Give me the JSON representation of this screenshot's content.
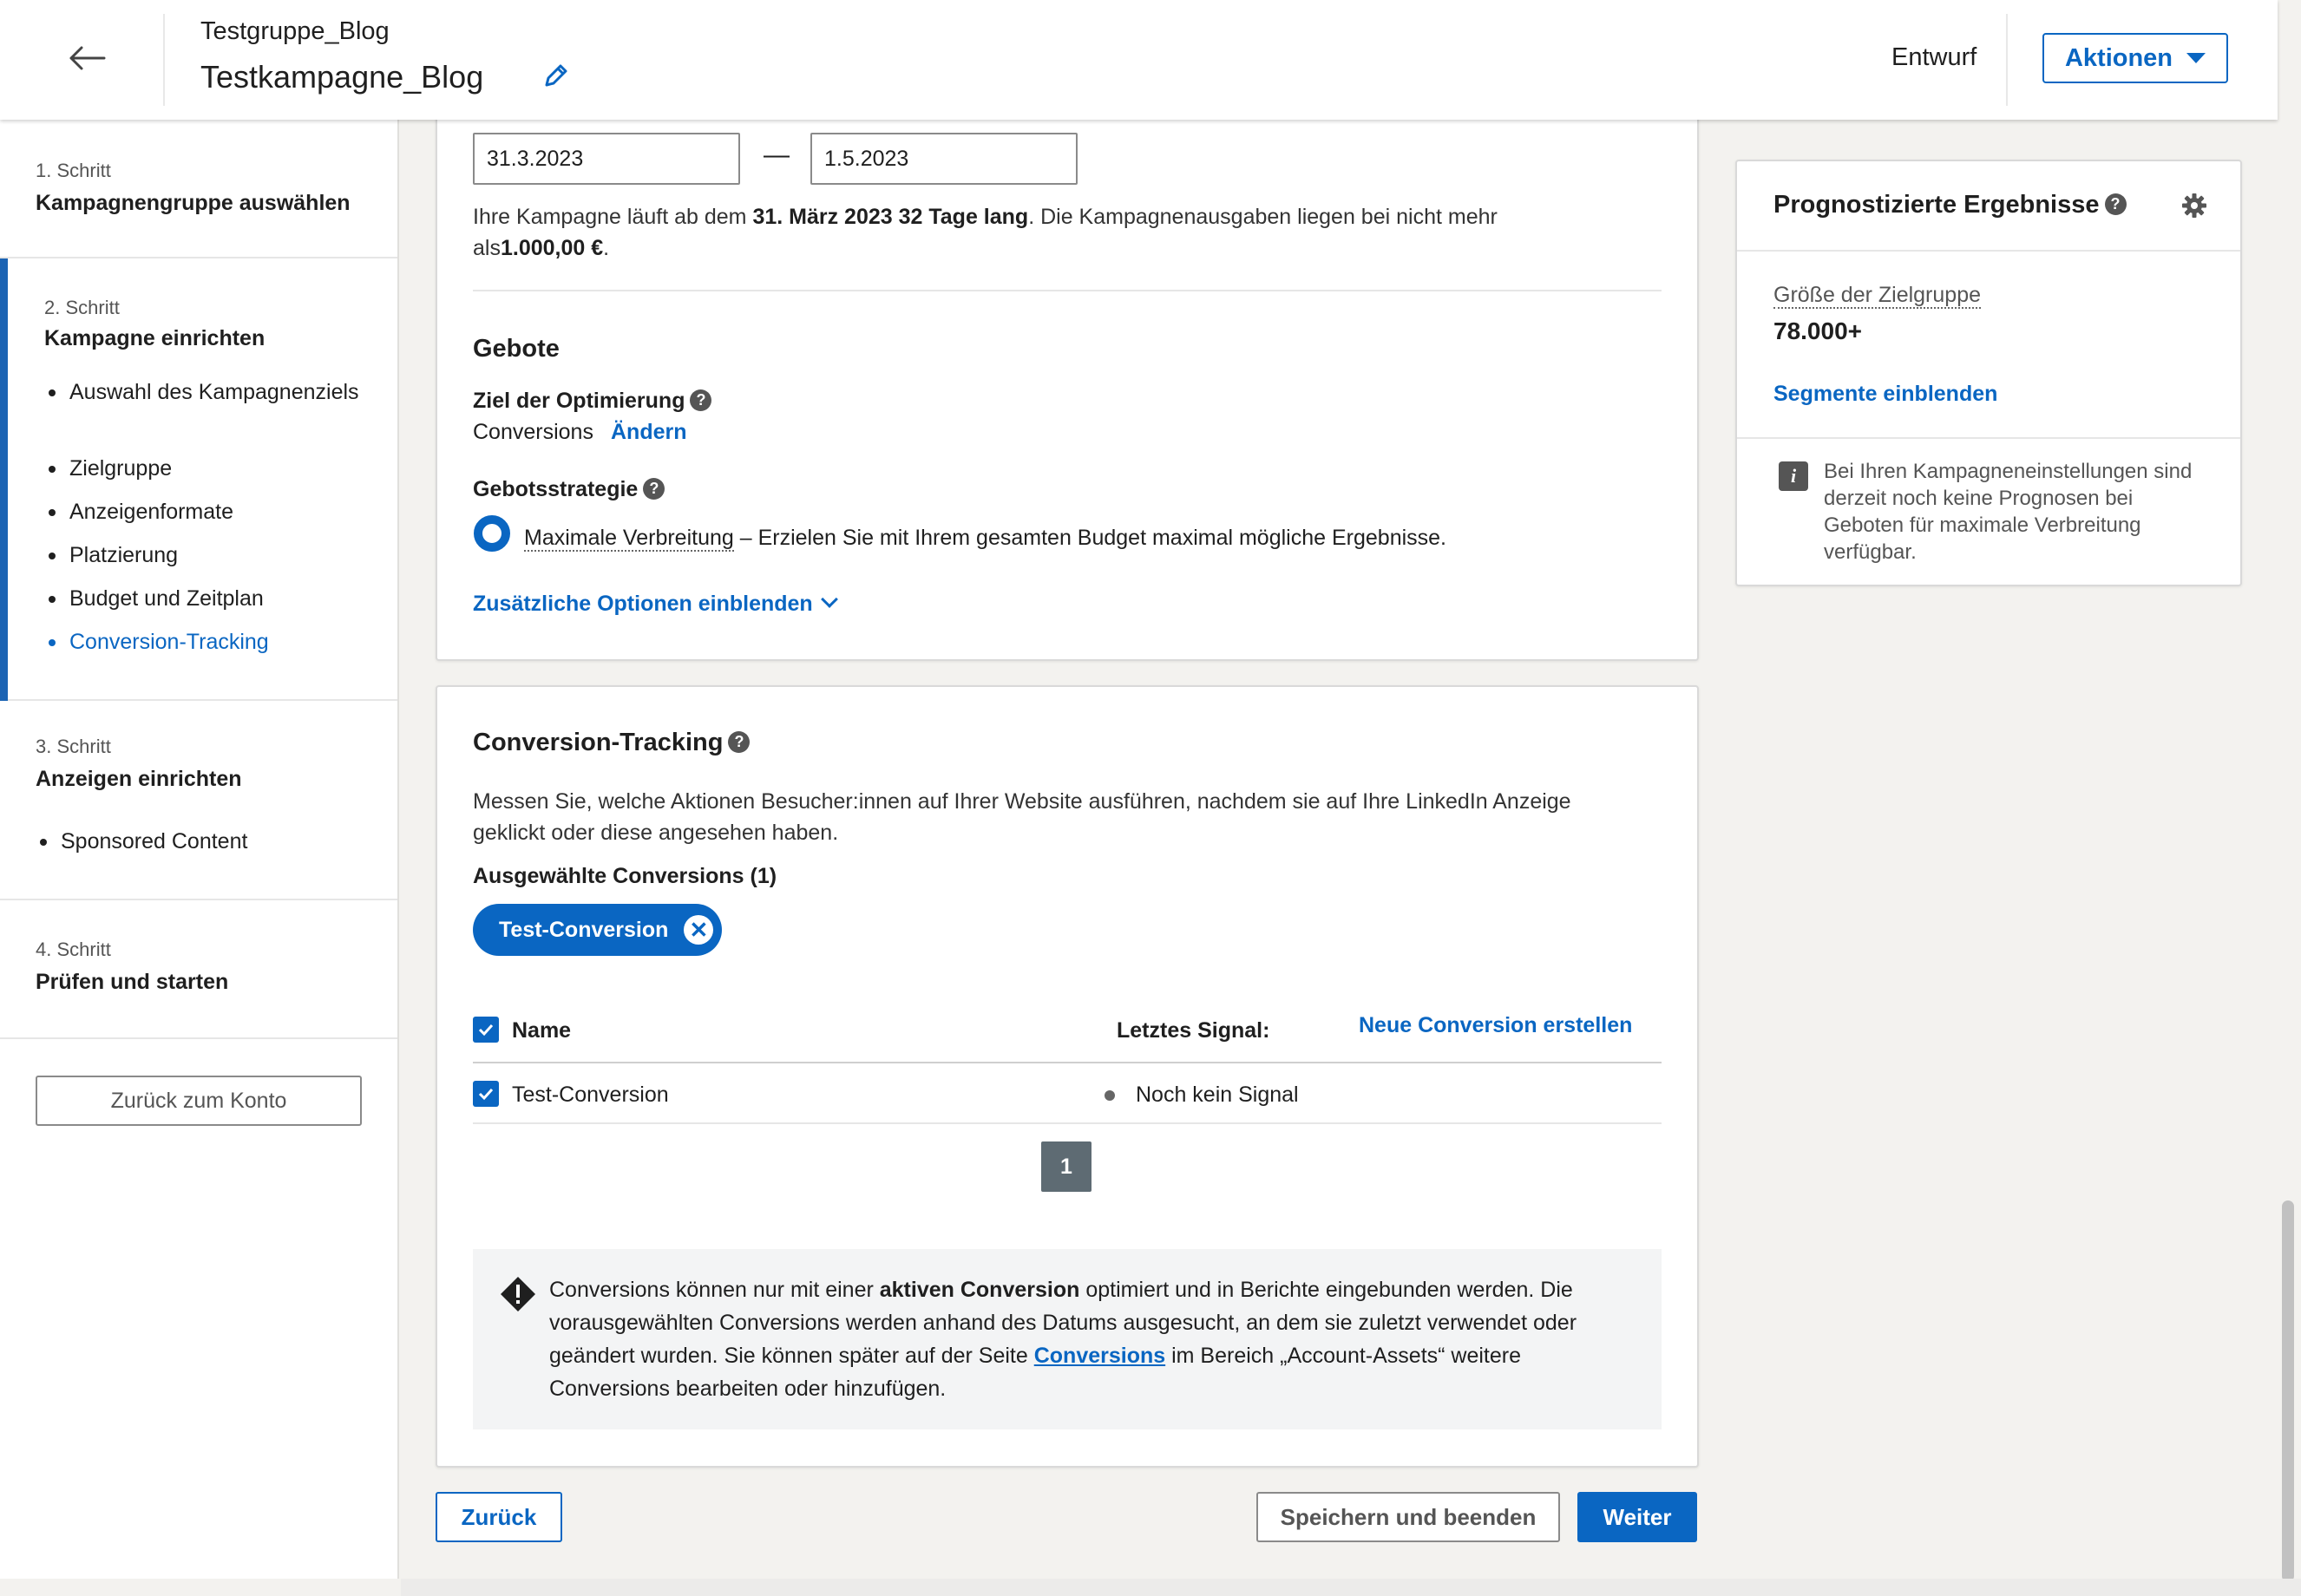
{
  "header": {
    "group_name": "Testgruppe_Blog",
    "campaign_name": "Testkampagne_Blog",
    "status": "Entwurf",
    "actions_label": "Aktionen"
  },
  "sidebar": {
    "steps": [
      {
        "num": "1. Schritt",
        "title": "Kampagnengruppe auswählen"
      },
      {
        "num": "2. Schritt",
        "title": "Kampagne einrichten",
        "substeps": [
          "Auswahl des Kampagnenziels",
          "Zielgruppe",
          "Anzeigenformate",
          "Platzierung",
          "Budget und Zeitplan",
          "Conversion-Tracking"
        ]
      },
      {
        "num": "3. Schritt",
        "title": "Anzeigen einrichten",
        "substeps": [
          "Sponsored Content"
        ]
      },
      {
        "num": "4. Schritt",
        "title": "Prüfen und starten"
      }
    ],
    "back_to_account": "Zurück zum Konto"
  },
  "schedule": {
    "start_date": "31.3.2023",
    "end_date": "1.5.2023",
    "dash": "—",
    "summary_pre": "Ihre Kampagne läuft ab dem ",
    "summary_bold": "31. März 2023 32 Tage lang",
    "summary_post": ". Die Kampagnenausgaben liegen bei nicht mehr als",
    "summary_amount": "1.000,00 €",
    "summary_end": "."
  },
  "bidding": {
    "title": "Gebote",
    "goal_label": "Ziel der Optimierung",
    "goal_value": "Conversions",
    "change_link": "Ändern",
    "strategy_label": "Gebotsstrategie",
    "strategy_option": "Maximale Verbreitung",
    "strategy_desc": " – Erzielen Sie mit Ihrem gesamten Budget maximal mögliche Ergebnisse.",
    "more_options": "Zusätzliche Optionen einblenden"
  },
  "conversion": {
    "title": "Conversion-Tracking",
    "desc": "Messen Sie, welche Aktionen Besucher:innen auf Ihrer Website ausführen, nachdem sie auf Ihre LinkedIn Anzeige geklickt oder diese angesehen haben.",
    "selected_label": "Ausgewählte Conversions (1)",
    "chip": "Test-Conversion",
    "col_name": "Name",
    "col_signal": "Letztes Signal:",
    "new_link": "Neue Conversion erstellen",
    "rows": [
      {
        "name": "Test-Conversion",
        "signal": "Noch kein Signal"
      }
    ],
    "page": "1",
    "notice_1": "Conversions können nur mit einer ",
    "notice_bold": "aktiven Conversion",
    "notice_2": " optimiert und in Berichte eingebunden werden. Die vorausgewählten Conversions werden anhand des Datums ausgesucht, an dem sie zuletzt verwendet oder geändert wurden. Sie können später auf der Seite ",
    "notice_link": "Conversions",
    "notice_3": " im Bereich „Account-Assets“ weitere Conversions bearbeiten oder hinzufügen."
  },
  "footer": {
    "back": "Zurück",
    "save_exit": "Speichern und beenden",
    "next": "Weiter"
  },
  "forecast": {
    "title": "Prognostizierte Ergebnisse",
    "audience_label": "Größe der Zielgruppe",
    "audience_value": "78.000+",
    "segments_link": "Segmente einblenden",
    "info_text": "Bei Ihren Kampagneneinstellungen sind derzeit noch keine Prognosen bei Geboten für maximale Verbreitung verfügbar."
  },
  "colors": {
    "accent": "#0a66c2",
    "sidebar_active": "#1b63b3"
  },
  "icons": [
    "back-arrow-icon",
    "pencil-icon",
    "chevron-down-icon",
    "help-icon",
    "gear-icon",
    "info-icon",
    "warning-icon",
    "check-icon",
    "close-icon"
  ]
}
